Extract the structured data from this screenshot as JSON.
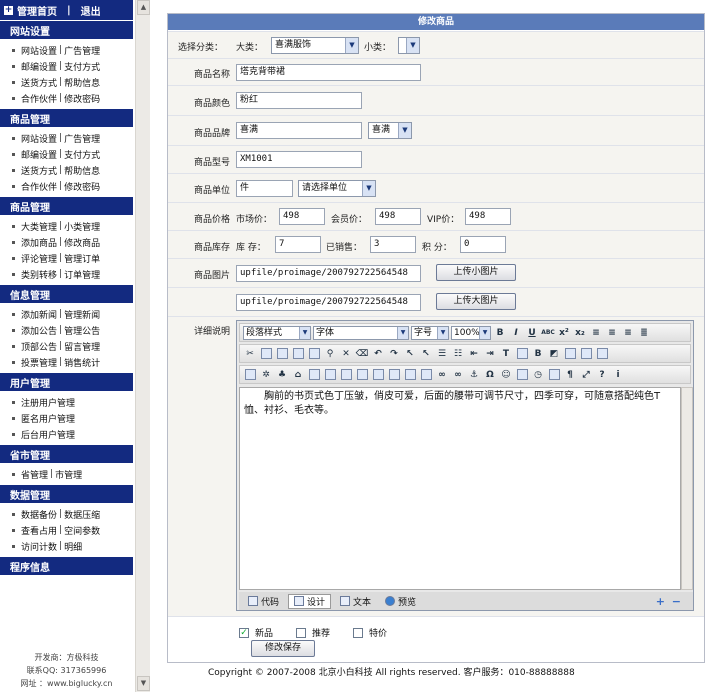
{
  "sidebar": {
    "top": {
      "home": "管理首页",
      "sep": "|",
      "logout": "退出"
    },
    "sections": [
      {
        "title": "网站设置",
        "rows": [
          [
            "网站设置",
            "广告管理"
          ],
          [
            "邮编设置",
            "支付方式"
          ],
          [
            "送货方式",
            "帮助信息"
          ],
          [
            "合作伙伴",
            "修改密码"
          ]
        ]
      },
      {
        "title": "商品管理",
        "rows": [
          [
            "网站设置",
            "广告管理"
          ],
          [
            "邮编设置",
            "支付方式"
          ],
          [
            "送货方式",
            "帮助信息"
          ],
          [
            "合作伙伴",
            "修改密码"
          ]
        ]
      },
      {
        "title": "商品管理",
        "rows": [
          [
            "大类管理",
            "小类管理"
          ],
          [
            "添加商品",
            "修改商品"
          ],
          [
            "评论管理",
            "管理订单"
          ],
          [
            "类别转移",
            "订单管理"
          ]
        ]
      },
      {
        "title": "信息管理",
        "rows": [
          [
            "添加新闻",
            "管理新闻"
          ],
          [
            "添加公告",
            "管理公告"
          ],
          [
            "顶部公告",
            "留言管理"
          ],
          [
            "投票管理",
            "销售统计"
          ]
        ]
      },
      {
        "title": "用户管理",
        "rows": [
          [
            "注册用户管理"
          ],
          [
            "匿名用户管理"
          ],
          [
            "后台用户管理"
          ]
        ]
      },
      {
        "title": "省市管理",
        "rows": [
          [
            "省管理",
            "市管理"
          ]
        ]
      },
      {
        "title": "数据管理",
        "rows": [
          [
            "数据备份",
            "数据压缩"
          ],
          [
            "查看占用",
            "空间参数"
          ],
          [
            "访问计数",
            "明细"
          ]
        ]
      },
      {
        "title": "程序信息",
        "rows": []
      }
    ],
    "credits": [
      "开发商：方极科技",
      "联系QQ: 317365996",
      "网址 ：www.biglucky.cn"
    ]
  },
  "form": {
    "header": "修改商品",
    "category": {
      "label": "选择分类：",
      "big_label": "大类：",
      "big_value": "喜满服饰",
      "small_label": "小类："
    },
    "name": {
      "label": "商品名称",
      "value": "塔克背带裙"
    },
    "color": {
      "label": "商品颜色",
      "value": "粉红"
    },
    "brand": {
      "label": "商品品牌",
      "value": "喜满",
      "select": "喜满"
    },
    "model": {
      "label": "商品型号",
      "value": "XM1001"
    },
    "unit": {
      "label": "商品单位",
      "value": "件",
      "select": "请选择单位"
    },
    "price": {
      "label": "商品价格",
      "market_label": "市场价：",
      "market": "498",
      "member_label": "会员价：",
      "member": "498",
      "vip_label": "VIP价：",
      "vip": "498"
    },
    "stock": {
      "label": "商品库存",
      "stock_label": "库 存：",
      "stock": "7",
      "sold_label": "已销售：",
      "sold": "3",
      "points_label": "积 分：",
      "points": "0"
    },
    "image": {
      "label": "商品图片",
      "small_path": "upfile/proimage/200792722564548",
      "small_btn": "上传小图片",
      "big_path": "upfile/proimage/200792722564548",
      "big_btn": "上传大图片"
    },
    "detail": {
      "label": "详细说明"
    },
    "flags": [
      {
        "label": "新品",
        "checked": true
      },
      {
        "label": "推荐",
        "checked": false
      },
      {
        "label": "特价",
        "checked": false
      }
    ],
    "save": "修改保存"
  },
  "editor": {
    "style_select": "段落样式",
    "font_select": "字体",
    "size_select": "字号",
    "zoom_select": "100%",
    "content": "胸前的书页式色丁压皱，俏皮可爱，后面的腰带可调节尺寸，四季可穿，可随意搭配纯色T恤、衬衫、毛衣等。",
    "tabs": [
      "代码",
      "设计",
      "文本",
      "预览"
    ]
  },
  "footer": {
    "text": "Copyright © 2007-2008 北京小白科技 All rights reserved. 客户服务：010-88888888"
  }
}
